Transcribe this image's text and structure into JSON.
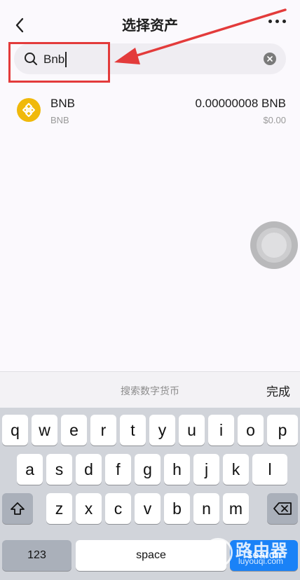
{
  "header": {
    "title": "选择资产"
  },
  "search": {
    "value": "Bnb",
    "placeholder": "搜索数字货币"
  },
  "assets": [
    {
      "symbol": "BNB",
      "network": "BNB",
      "balance": "0.00000008 BNB",
      "fiat": "$0.00",
      "icon": "bnb-icon"
    }
  ],
  "accessory": {
    "placeholder": "搜索数字货币",
    "done_label": "完成"
  },
  "keyboard": {
    "row1": [
      "q",
      "w",
      "e",
      "r",
      "t",
      "y",
      "u",
      "i",
      "o",
      "p"
    ],
    "row2": [
      "a",
      "s",
      "d",
      "f",
      "g",
      "h",
      "j",
      "k",
      "l"
    ],
    "row3": [
      "z",
      "x",
      "c",
      "v",
      "b",
      "n",
      "m"
    ],
    "numbers_label": "123",
    "space_label": "space",
    "search_label": "search"
  },
  "watermark": {
    "brand": "路由器",
    "site": "luyouqi.com"
  },
  "colors": {
    "annotation": "#e33b3b",
    "bnb": "#f0b90b",
    "search_key": "#1a82f7"
  }
}
